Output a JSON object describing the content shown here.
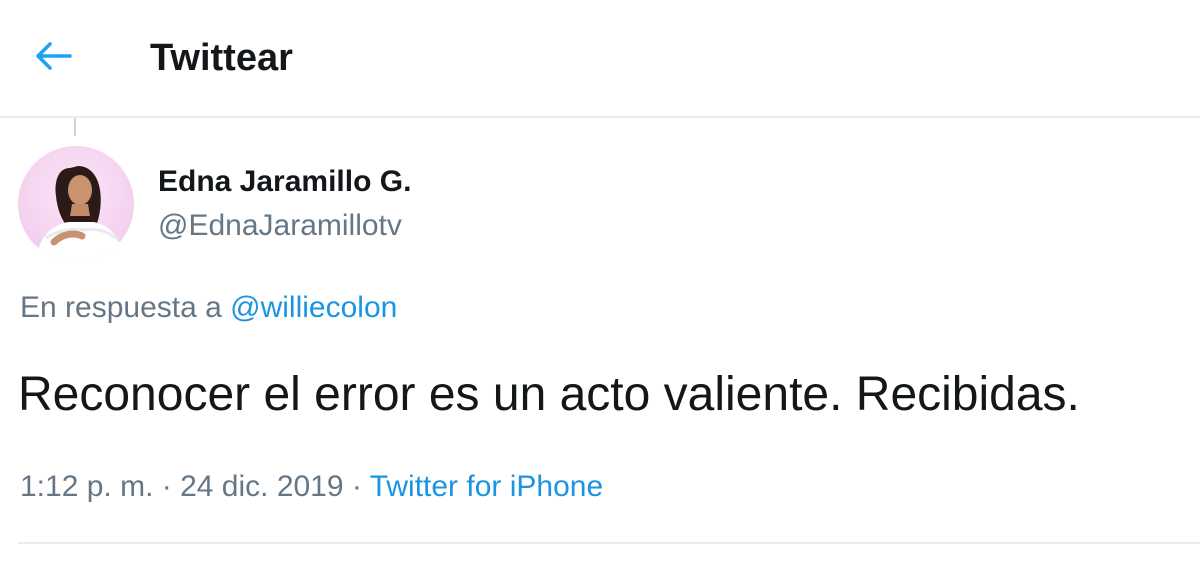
{
  "header": {
    "back_icon": "arrow-left-icon",
    "title": "Twittear",
    "accent_color": "#1da1f2"
  },
  "tweet": {
    "author": {
      "display_name": "Edna Jaramillo G.",
      "handle": "@EdnaJaramillotv",
      "avatar_icon": "user-avatar"
    },
    "reply_prefix": "En respuesta a",
    "reply_to": "@williecolon",
    "text": "Reconocer el error es un acto valiente. Recibidas.",
    "time": "1:12 p. m.",
    "separator": "·",
    "date": "24 dic. 2019",
    "source": "Twitter for iPhone"
  }
}
